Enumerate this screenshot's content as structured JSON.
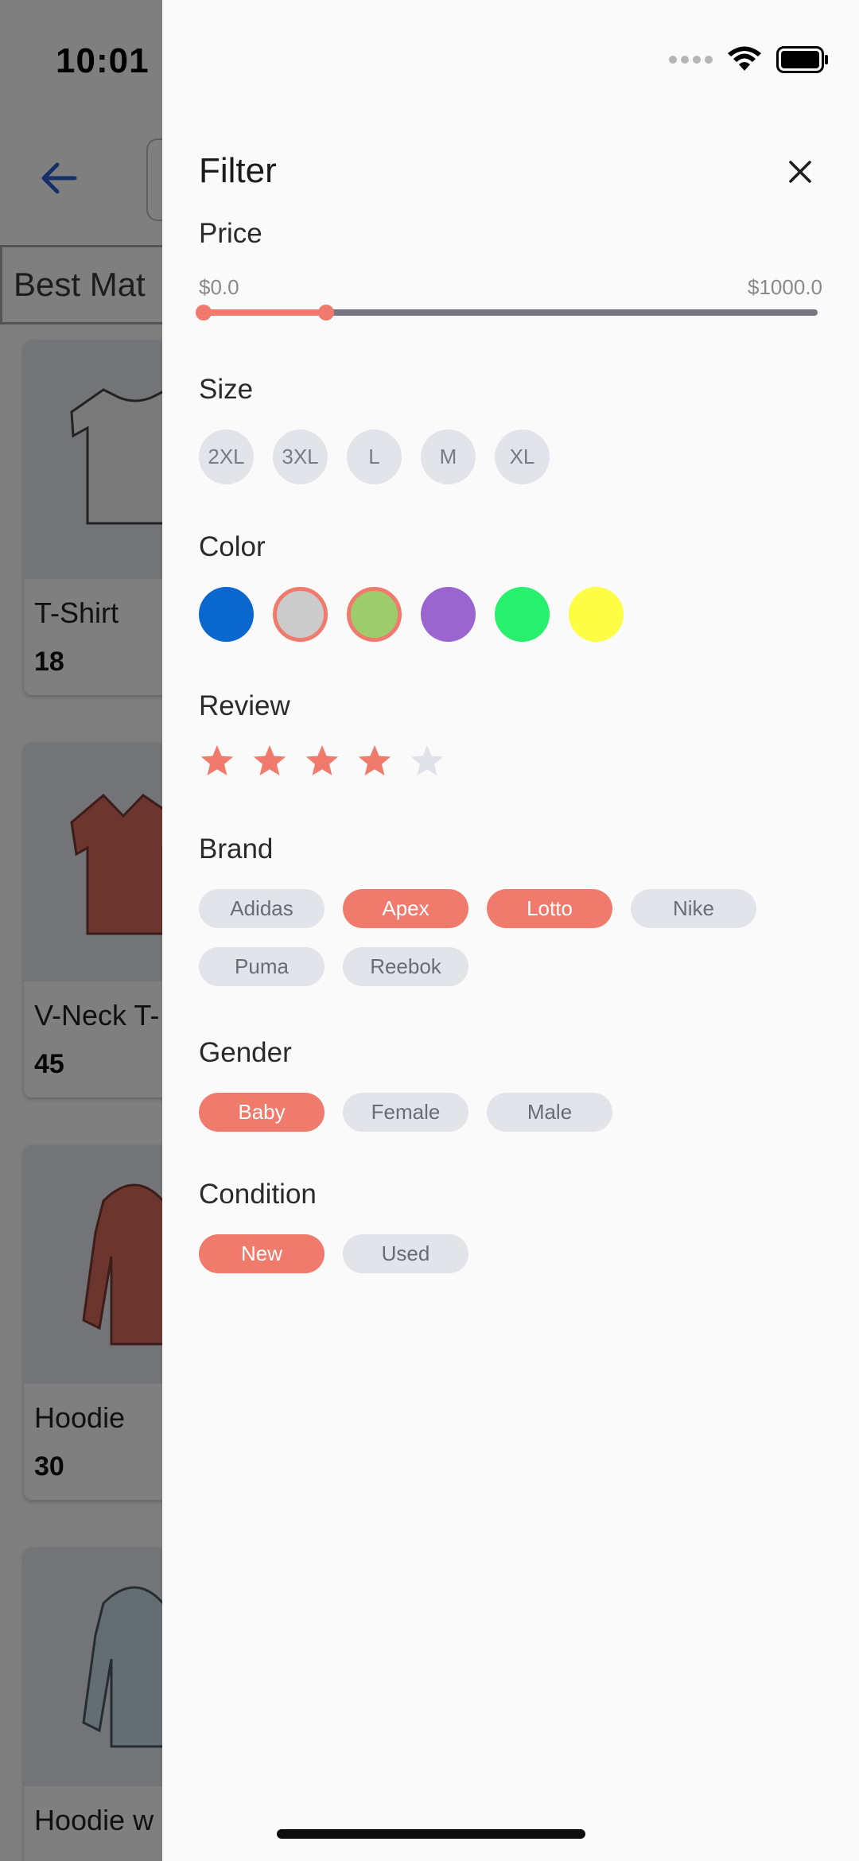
{
  "status_bar": {
    "time": "10:01"
  },
  "background": {
    "sort_label": "Best Mat",
    "products": [
      {
        "name": "T-Shirt",
        "price": "18"
      },
      {
        "name": "V-Neck T-",
        "price": "45"
      },
      {
        "name": "Hoodie",
        "price": "30"
      },
      {
        "name": "Hoodie w",
        "price": ""
      }
    ]
  },
  "filter": {
    "title": "Filter",
    "price": {
      "label": "Price",
      "min_label": "$0.0",
      "max_label": "$1000.0",
      "range_low_fraction": 0.0,
      "range_high_fraction": 0.2
    },
    "size": {
      "label": "Size",
      "options": [
        "2XL",
        "3XL",
        "L",
        "M",
        "XL"
      ]
    },
    "color": {
      "label": "Color",
      "swatches": [
        {
          "name": "blue",
          "hex": "#0a67cd",
          "selected": false
        },
        {
          "name": "light-gray",
          "hex": "#cbcbcb",
          "selected": true
        },
        {
          "name": "light-green",
          "hex": "#9ccc6b",
          "selected": true
        },
        {
          "name": "purple",
          "hex": "#9a65cf",
          "selected": false
        },
        {
          "name": "green",
          "hex": "#27f06e",
          "selected": false
        },
        {
          "name": "yellow",
          "hex": "#fdfd43",
          "selected": false
        }
      ]
    },
    "review": {
      "label": "Review",
      "rating": 4,
      "max": 5
    },
    "brand": {
      "label": "Brand",
      "options": [
        {
          "label": "Adidas",
          "active": false
        },
        {
          "label": "Apex",
          "active": true
        },
        {
          "label": "Lotto",
          "active": true
        },
        {
          "label": "Nike",
          "active": false
        },
        {
          "label": "Puma",
          "active": false
        },
        {
          "label": "Reebok",
          "active": false
        }
      ]
    },
    "gender": {
      "label": "Gender",
      "options": [
        {
          "label": "Baby",
          "active": true
        },
        {
          "label": "Female",
          "active": false
        },
        {
          "label": "Male",
          "active": false
        }
      ]
    },
    "condition": {
      "label": "Condition",
      "options": [
        {
          "label": "New",
          "active": true
        },
        {
          "label": "Used",
          "active": false
        }
      ]
    }
  },
  "colors": {
    "accent": "#f07b6c",
    "chip_bg": "#e3e3ea",
    "star_empty": "#e1e1ea",
    "back_arrow": "#2f5fd0"
  }
}
